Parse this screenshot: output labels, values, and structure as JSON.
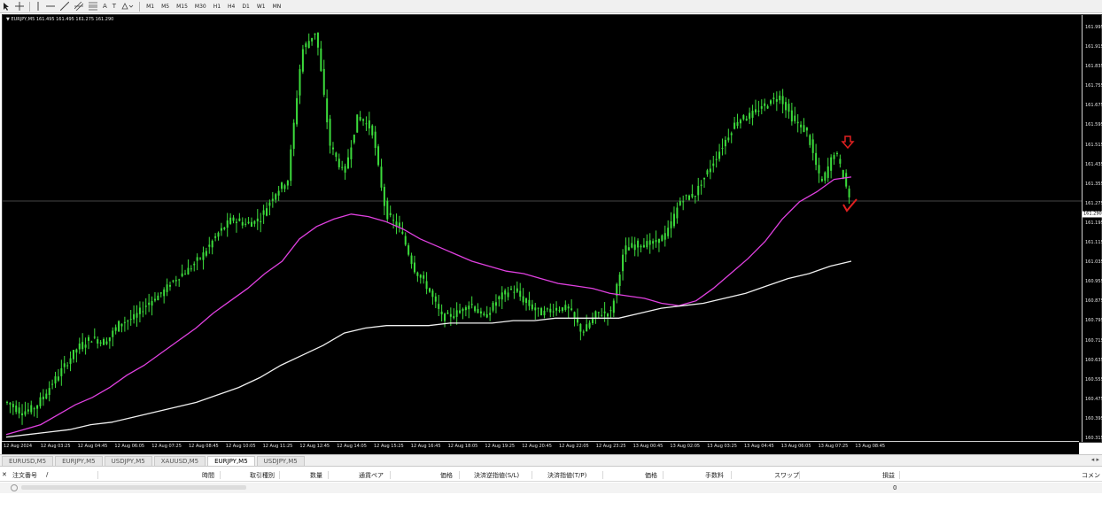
{
  "toolbar": {
    "icons": [
      "cursor-icon",
      "crosshair-icon",
      "vertical-line-icon",
      "horizontal-line-icon",
      "trendline-icon",
      "channel-icon",
      "fibonacci-icon",
      "text-icon",
      "label-icon",
      "shapes-icon"
    ],
    "text_tool_label": "A",
    "label_tool_label": "T",
    "timeframes": [
      "M1",
      "M5",
      "M15",
      "M30",
      "H1",
      "H4",
      "D1",
      "W1",
      "MN"
    ]
  },
  "chart": {
    "info_symbol": "EURJPY,M5",
    "info_prices": "161.495 161.495 161.275 161.290",
    "current_price": "161.290",
    "price_axis_labels": [
      "161.995",
      "161.915",
      "161.835",
      "161.755",
      "161.675",
      "161.595",
      "161.515",
      "161.435",
      "161.355",
      "161.275",
      "161.195",
      "161.115",
      "161.035",
      "160.955",
      "160.875",
      "160.795",
      "160.715",
      "160.635",
      "160.555",
      "160.475",
      "160.395",
      "160.315"
    ],
    "time_axis_labels": [
      "12 Aug 2024",
      "12 Aug 03:25",
      "12 Aug 04:45",
      "12 Aug 06:05",
      "12 Aug 07:25",
      "12 Aug 08:45",
      "12 Aug 10:05",
      "12 Aug 11:25",
      "12 Aug 12:45",
      "12 Aug 14:05",
      "12 Aug 15:25",
      "12 Aug 16:45",
      "12 Aug 18:05",
      "12 Aug 19:25",
      "12 Aug 20:45",
      "12 Aug 22:05",
      "12 Aug 23:25",
      "13 Aug 00:45",
      "13 Aug 02:05",
      "13 Aug 03:25",
      "13 Aug 04:45",
      "13 Aug 06:05",
      "13 Aug 07:25",
      "13 Aug 08:45"
    ],
    "colors": {
      "background": "#000000",
      "candles": "#3cdc3c",
      "ma_fast": "#e040e0",
      "ma_slow": "#f0f0f0",
      "arrow": "#e02020"
    }
  },
  "chart_data": {
    "type": "line",
    "ylim": [
      160.315,
      161.995
    ],
    "grid": false,
    "series": [
      {
        "values": [
          160.46,
          160.42,
          160.44,
          160.52,
          160.6,
          160.68,
          160.72,
          160.7,
          160.78,
          160.8,
          160.86,
          160.9,
          160.96,
          161.0,
          161.06,
          161.14,
          161.2,
          161.18,
          161.2,
          161.3,
          161.36,
          161.88,
          161.96,
          161.5,
          161.38,
          161.62,
          161.56,
          161.22,
          161.16,
          161.0,
          160.92,
          160.8,
          160.82,
          160.86,
          160.8,
          160.88,
          160.92,
          160.86,
          160.82,
          160.84,
          160.84,
          160.74,
          160.82,
          160.82,
          161.08,
          161.1,
          161.1,
          161.14,
          161.28,
          161.3,
          161.4,
          161.5,
          161.6,
          161.62,
          161.66,
          161.7,
          161.6,
          161.55,
          161.34,
          161.48,
          161.29
        ]
      },
      {
        "values": [
          160.33,
          160.35,
          160.37,
          160.41,
          160.45,
          160.48,
          160.52,
          160.57,
          160.61,
          160.66,
          160.71,
          160.76,
          160.82,
          160.87,
          160.92,
          160.98,
          161.03,
          161.12,
          161.17,
          161.2,
          161.22,
          161.21,
          161.19,
          161.16,
          161.12,
          161.09,
          161.06,
          161.03,
          161.01,
          160.99,
          160.98,
          160.96,
          160.94,
          160.93,
          160.92,
          160.9,
          160.89,
          160.88,
          160.86,
          160.85,
          160.87,
          160.92,
          160.98,
          161.04,
          161.11,
          161.2,
          161.27,
          161.31,
          161.36,
          161.37
        ]
      },
      {
        "values": [
          160.32,
          160.33,
          160.34,
          160.35,
          160.37,
          160.38,
          160.4,
          160.42,
          160.44,
          160.46,
          160.49,
          160.52,
          160.56,
          160.61,
          160.65,
          160.69,
          160.74,
          160.76,
          160.77,
          160.77,
          160.77,
          160.78,
          160.78,
          160.78,
          160.79,
          160.79,
          160.8,
          160.8,
          160.8,
          160.8,
          160.82,
          160.84,
          160.85,
          160.86,
          160.88,
          160.9,
          160.93,
          160.96,
          160.98,
          161.01,
          161.03
        ]
      }
    ]
  },
  "tabs": {
    "items": [
      "EURUSD,M5",
      "EURJPY,M5",
      "USDJPY,M5",
      "XAUUSD,M5",
      "EURJPY,M5",
      "USDJPY,M5"
    ],
    "active_index": 4
  },
  "terminal": {
    "columns": [
      "注文番号",
      "/",
      "時間",
      "取引種別",
      "数量",
      "通貨ペア",
      "価格",
      "決済逆指値(S/L)",
      "決済指値(T/P)",
      "価格",
      "手数料",
      "スワップ",
      "",
      "損益",
      "コメント"
    ],
    "balance_value": "0"
  }
}
